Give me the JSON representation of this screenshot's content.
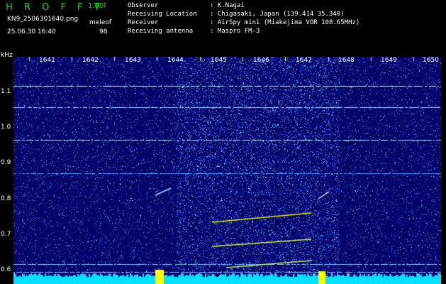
{
  "app": {
    "logo": "H R O F F T",
    "version": "1.00f",
    "filename": "KN9_2506301640.png",
    "mode": "meleof",
    "datetime": "25.06.30 16:40",
    "count": "98"
  },
  "metadata": [
    {
      "key": "Observer",
      "value": ": K.Nagai"
    },
    {
      "key": "Receiving Location",
      "value": ": Chigasaki, Japan (139.414 35.340)"
    },
    {
      "key": "Receiver",
      "value": ": AirSpy mini (Miakejima VOR 108.65MHz)"
    },
    {
      "key": "Receiving antenna",
      "value": ": Maspro FM-3"
    }
  ],
  "y_axis": {
    "unit": "kHz",
    "ticks": [
      "1.1",
      "1.0",
      "0.9",
      "0.8",
      "0.7",
      "0.6"
    ]
  },
  "x_axis": {
    "ticks": [
      "1641",
      "1642",
      "1643",
      "1644",
      "1645",
      "1646",
      "1647",
      "1648",
      "1649",
      "1650"
    ]
  },
  "colors": {
    "background": "#000000",
    "plot_bg": "#03036a",
    "logo_green": "#1fd21f",
    "signal_cyan": "#00e0ff",
    "signal_yellow": "#e8f000"
  }
}
